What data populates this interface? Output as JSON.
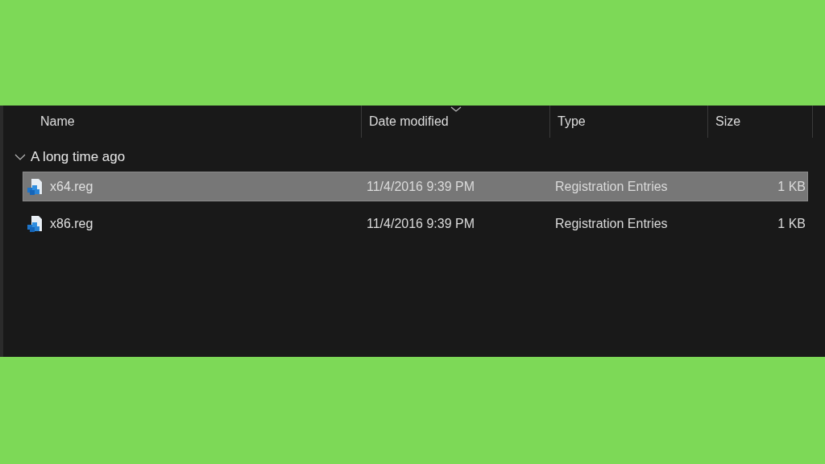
{
  "columns": [
    {
      "label": "Name",
      "sorted": false
    },
    {
      "label": "Date modified",
      "sorted": true
    },
    {
      "label": "Type",
      "sorted": false
    },
    {
      "label": "Size",
      "sorted": false
    }
  ],
  "group": {
    "label": "A long time ago",
    "expanded": true,
    "files": [
      {
        "name": "x64.reg",
        "date": "11/4/2016 9:39 PM",
        "type": "Registration Entries",
        "size": "1 KB",
        "selected": true
      },
      {
        "name": "x86.reg",
        "date": "11/4/2016 9:39 PM",
        "type": "Registration Entries",
        "size": "1 KB",
        "selected": false
      }
    ]
  }
}
